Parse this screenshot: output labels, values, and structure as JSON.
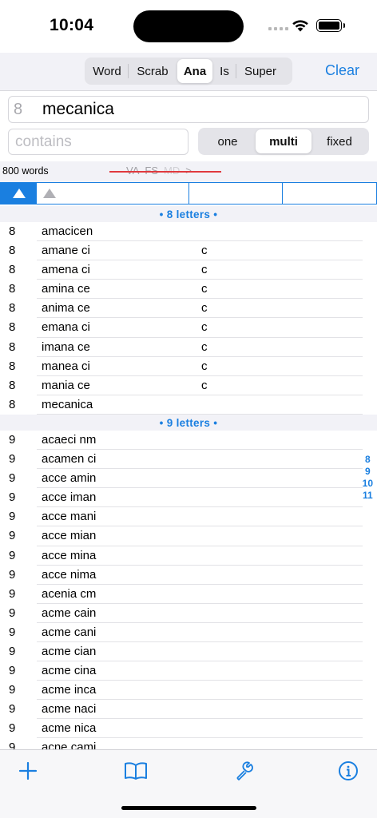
{
  "status": {
    "time": "10:04"
  },
  "modes": {
    "items": [
      "Word",
      "Scrab",
      "Ana",
      "Is",
      "Super"
    ],
    "selected_index": 2
  },
  "clear_label": "Clear",
  "query": {
    "letter_count": "8",
    "word": "mecanica"
  },
  "contains": {
    "placeholder": "contains",
    "value": ""
  },
  "match": {
    "items": [
      "one",
      "multi",
      "fixed"
    ],
    "selected_index": 1
  },
  "info": {
    "word_count": "800 words",
    "flags": [
      "VA",
      "FS",
      "MD",
      ">"
    ]
  },
  "colors": {
    "accent": "#1a7fe0",
    "strike": "#e0393e"
  },
  "sections": [
    {
      "title": "• 8 letters •",
      "rows": [
        {
          "len": "8",
          "word": "amacicen",
          "extra": ""
        },
        {
          "len": "8",
          "word": "amane ci",
          "extra": "c"
        },
        {
          "len": "8",
          "word": "amena ci",
          "extra": "c"
        },
        {
          "len": "8",
          "word": "amina ce",
          "extra": "c"
        },
        {
          "len": "8",
          "word": "anima ce",
          "extra": "c"
        },
        {
          "len": "8",
          "word": "emana ci",
          "extra": "c"
        },
        {
          "len": "8",
          "word": "imana ce",
          "extra": "c"
        },
        {
          "len": "8",
          "word": "manea ci",
          "extra": "c"
        },
        {
          "len": "8",
          "word": "mania ce",
          "extra": "c"
        },
        {
          "len": "8",
          "word": "mecanica",
          "extra": ""
        }
      ]
    },
    {
      "title": "• 9 letters •",
      "rows": [
        {
          "len": "9",
          "word": "acaeci nm",
          "extra": ""
        },
        {
          "len": "9",
          "word": "acamen ci",
          "extra": ""
        },
        {
          "len": "9",
          "word": "acce amin",
          "extra": ""
        },
        {
          "len": "9",
          "word": "acce iman",
          "extra": ""
        },
        {
          "len": "9",
          "word": "acce mani",
          "extra": ""
        },
        {
          "len": "9",
          "word": "acce mian",
          "extra": ""
        },
        {
          "len": "9",
          "word": "acce mina",
          "extra": ""
        },
        {
          "len": "9",
          "word": "acce nima",
          "extra": ""
        },
        {
          "len": "9",
          "word": "acenia cm",
          "extra": ""
        },
        {
          "len": "9",
          "word": "acme cain",
          "extra": ""
        },
        {
          "len": "9",
          "word": "acme cani",
          "extra": ""
        },
        {
          "len": "9",
          "word": "acme cian",
          "extra": ""
        },
        {
          "len": "9",
          "word": "acme cina",
          "extra": ""
        },
        {
          "len": "9",
          "word": "acme inca",
          "extra": ""
        },
        {
          "len": "9",
          "word": "acme naci",
          "extra": ""
        },
        {
          "len": "9",
          "word": "acme nica",
          "extra": ""
        },
        {
          "len": "9",
          "word": "acne cami",
          "extra": ""
        }
      ]
    }
  ],
  "index_items": [
    "8",
    "9",
    "10",
    "11"
  ],
  "tabs": [
    {
      "name": "plus-icon"
    },
    {
      "name": "book-icon"
    },
    {
      "name": "wrench-icon"
    },
    {
      "name": "info-icon"
    }
  ]
}
